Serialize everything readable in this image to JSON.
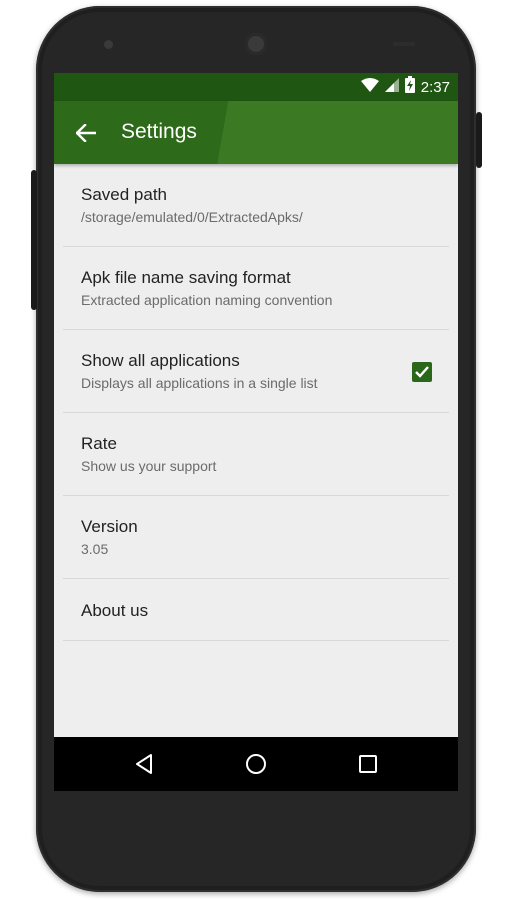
{
  "status_bar": {
    "time": "2:37",
    "icons": [
      "wifi-icon",
      "signal-icon",
      "battery-charging-icon"
    ]
  },
  "app_bar": {
    "title": "Settings",
    "back_icon": "arrow-back-icon"
  },
  "settings": [
    {
      "title": "Saved path",
      "summary": "/storage/emulated/0/ExtractedApks/"
    },
    {
      "title": "Apk file name saving format",
      "summary": "Extracted application naming convention"
    },
    {
      "title": "Show all applications",
      "summary": "Displays all applications in a single list",
      "checked": true
    },
    {
      "title": "Rate",
      "summary": "Show us your support"
    },
    {
      "title": "Version",
      "summary": "3.05"
    },
    {
      "title": "About us"
    }
  ],
  "nav_bar": {
    "icons": [
      "back-triangle-icon",
      "home-circle-icon",
      "recents-square-icon"
    ]
  },
  "colors": {
    "primary": "#3b7a22",
    "primary_dark": "#1f5612",
    "accent_checkbox": "#2b6718",
    "background": "#eeeeee"
  }
}
